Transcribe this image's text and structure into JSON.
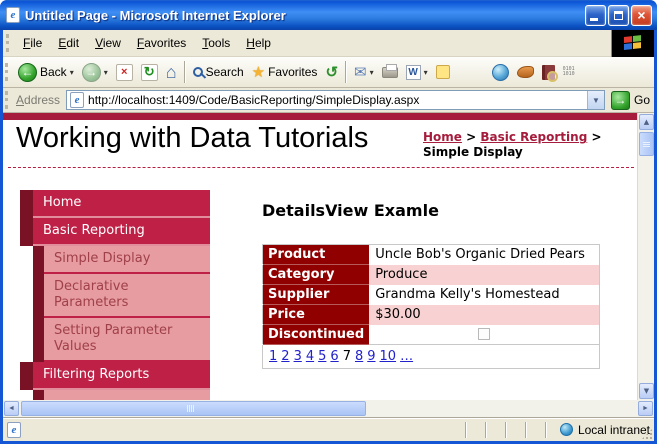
{
  "window": {
    "title": "Untitled Page - Microsoft Internet Explorer"
  },
  "menu": {
    "items": [
      "File",
      "Edit",
      "View",
      "Favorites",
      "Tools",
      "Help"
    ]
  },
  "toolbar": {
    "back": "Back",
    "search": "Search",
    "favorites": "Favorites"
  },
  "address": {
    "label": "Address",
    "url": "http://localhost:1409/Code/BasicReporting/SimpleDisplay.aspx",
    "go": "Go"
  },
  "page": {
    "title": "Working with Data Tutorials",
    "breadcrumb": {
      "home": "Home",
      "section": "Basic Reporting",
      "current": "Simple Display",
      "separator": ">"
    },
    "sidebar": {
      "items": [
        {
          "label": "Home",
          "level": 1
        },
        {
          "label": "Basic Reporting",
          "level": 1
        },
        {
          "label": "Simple Display",
          "level": 2
        },
        {
          "label": "Declarative Parameters",
          "level": 2
        },
        {
          "label": "Setting Parameter Values",
          "level": 2
        },
        {
          "label": "Filtering Reports",
          "level": 1
        },
        {
          "label": "",
          "level": 2
        }
      ]
    },
    "content": {
      "heading": "DetailsView Examle",
      "details_table": {
        "rows": [
          {
            "label": "Product",
            "value": "Uncle Bob's Organic Dried Pears"
          },
          {
            "label": "Category",
            "value": "Produce"
          },
          {
            "label": "Supplier",
            "value": "Grandma Kelly's Homestead"
          },
          {
            "label": "Price",
            "value": "$30.00"
          },
          {
            "label": "Discontinued",
            "value": ""
          }
        ],
        "discontinued_checked": false,
        "pager": {
          "items": [
            "1",
            "2",
            "3",
            "4",
            "5",
            "6",
            "7",
            "8",
            "9",
            "10",
            "…"
          ],
          "current": "7"
        }
      }
    }
  },
  "status": {
    "zone": "Local intranet"
  },
  "icons": {
    "ie": "e",
    "close": "×",
    "back": "←",
    "forward": "→",
    "stop": "×",
    "refresh": "↻",
    "home": "⌂",
    "star": "★",
    "history": "↺",
    "mail": "✉",
    "word": "W",
    "caret": "▾",
    "combo": "▼",
    "go": "→",
    "up": "▲",
    "down": "▼",
    "left": "◄",
    "right": "►"
  },
  "colors": {
    "crimson": "#BE2046",
    "maroon_block": "#7A1226",
    "top_bar": "#A61C3C",
    "submenu_pink": "#E79CA2",
    "submenu_text": "#A04048",
    "table_header": "#900000",
    "alt_row_pink": "#F8D2D2",
    "link_blue": "#2222CC",
    "breadcrumb_link": "#A61C3C",
    "chrome_tan": "#ECE9D8"
  }
}
